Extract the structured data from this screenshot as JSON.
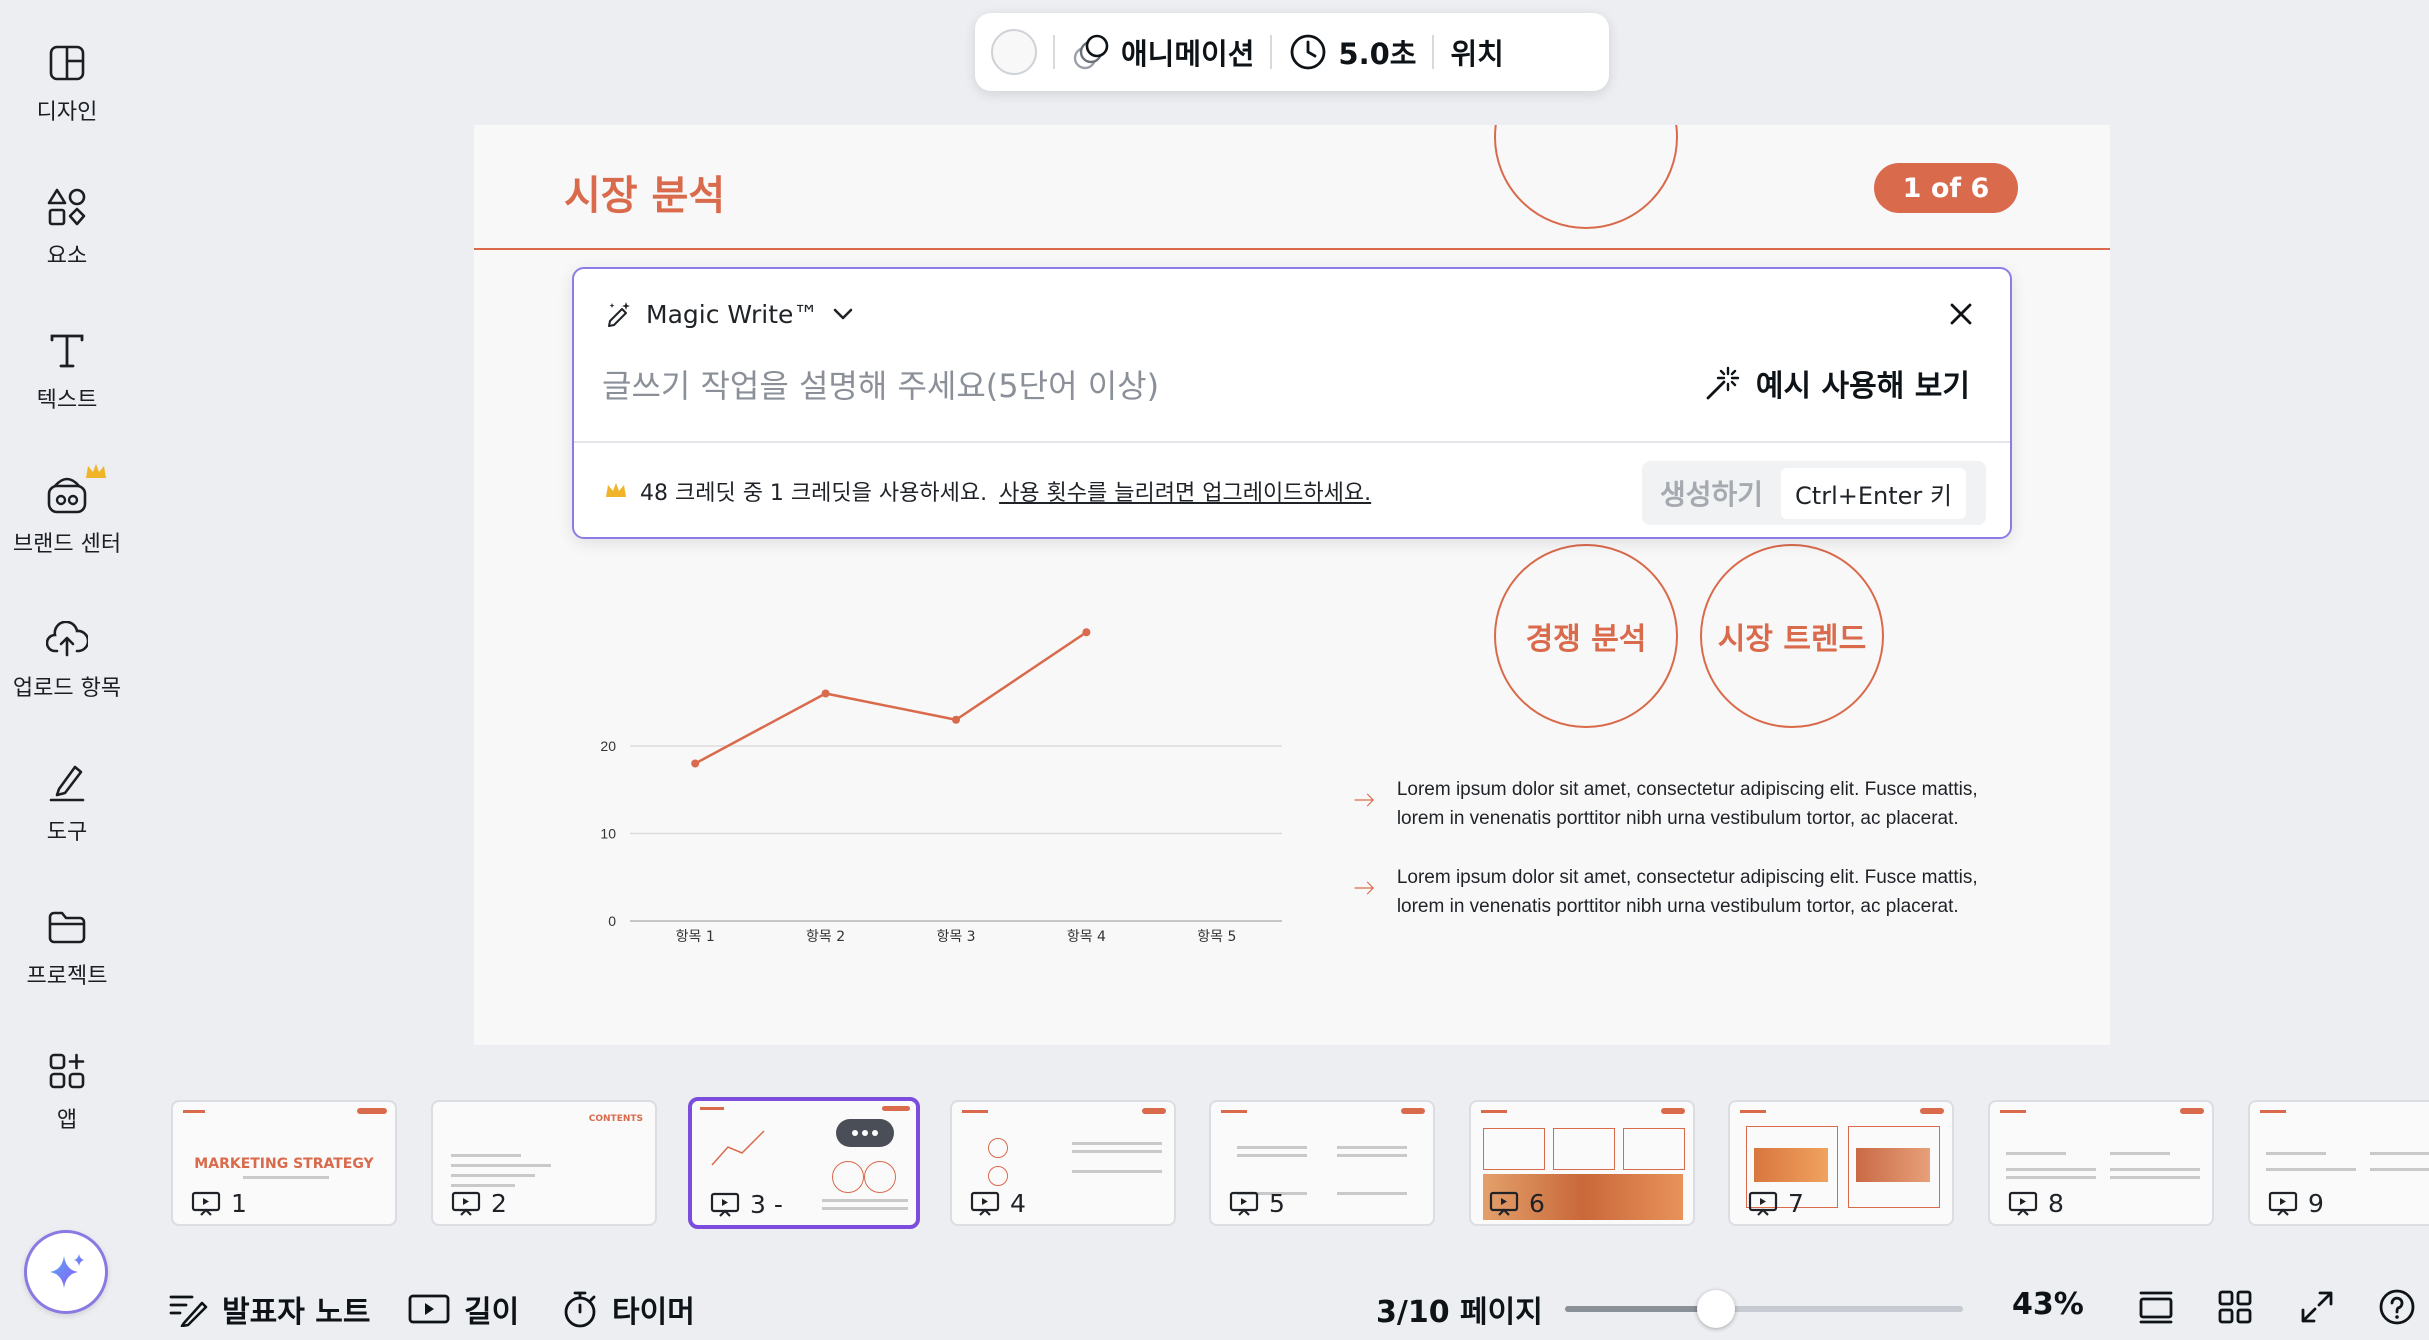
{
  "sidebar": {
    "items": [
      {
        "label": "디자인",
        "icon": "design-icon"
      },
      {
        "label": "요소",
        "icon": "elements-icon"
      },
      {
        "label": "텍스트",
        "icon": "text-icon"
      },
      {
        "label": "브랜드 센터",
        "icon": "brand-icon"
      },
      {
        "label": "업로드 항목",
        "icon": "upload-icon"
      },
      {
        "label": "도구",
        "icon": "draw-icon"
      },
      {
        "label": "프로젝트",
        "icon": "folder-icon"
      },
      {
        "label": "앱",
        "icon": "apps-icon"
      }
    ],
    "magic_button_icon": "sparkle-icon"
  },
  "toolbar": {
    "animation_label": "애니메이션",
    "duration_label": "5.0초",
    "position_label": "위치"
  },
  "slide": {
    "title": "시장 분석",
    "badge": "1 of 6",
    "circles": [
      "경쟁 분석",
      "시장 트렌드"
    ],
    "bullets": [
      "Lorem ipsum dolor sit amet, consectetur adipiscing elit. Fusce mattis, lorem in venenatis porttitor nibh urna vestibulum tortor, ac placerat.",
      "Lorem ipsum dolor sit amet, consectetur adipiscing elit. Fusce mattis, lorem in venenatis porttitor nibh urna vestibulum tortor, ac placerat."
    ]
  },
  "chart_data": {
    "type": "line",
    "categories": [
      "항목 1",
      "항목 2",
      "항목 3",
      "항목 4",
      "항목 5"
    ],
    "series": [
      {
        "values": [
          18,
          26,
          23,
          33,
          null
        ]
      }
    ],
    "yticks": [
      0,
      10,
      20
    ],
    "ylim": [
      0,
      40
    ],
    "color": "#d96a4b"
  },
  "magic_write": {
    "title": "Magic Write™",
    "placeholder": "글쓰기 작업을 설명해 주세요(5단어 이상)",
    "example_label": "예시 사용해 보기",
    "credit_text": "48 크레딧 중 1 크레딧을 사용하세요.",
    "upgrade_link": "사용 횟수를 늘리려면 업그레이드하세요.",
    "generate_label": "생성하기",
    "shortcut_label": "Ctrl+Enter 키"
  },
  "thumbnails": [
    {
      "num": "1"
    },
    {
      "num": "2"
    },
    {
      "num": "3 -"
    },
    {
      "num": "4"
    },
    {
      "num": "5"
    },
    {
      "num": "6"
    },
    {
      "num": "7"
    },
    {
      "num": "8"
    },
    {
      "num": "9"
    }
  ],
  "thumbnail_texts": {
    "t1_title": "MARKETING STRATEGY",
    "t2_title": "CONTENTS"
  },
  "bottom": {
    "notes_label": "발표자 노트",
    "duration_label": "길이",
    "timer_label": "타이머",
    "page_label": "3/10 페이지",
    "zoom_label": "43%",
    "zoom_level": 0.38
  },
  "colors": {
    "accent": "#d96a4b",
    "selection": "#7c4ddc",
    "magic_border": "#8f7be6"
  }
}
